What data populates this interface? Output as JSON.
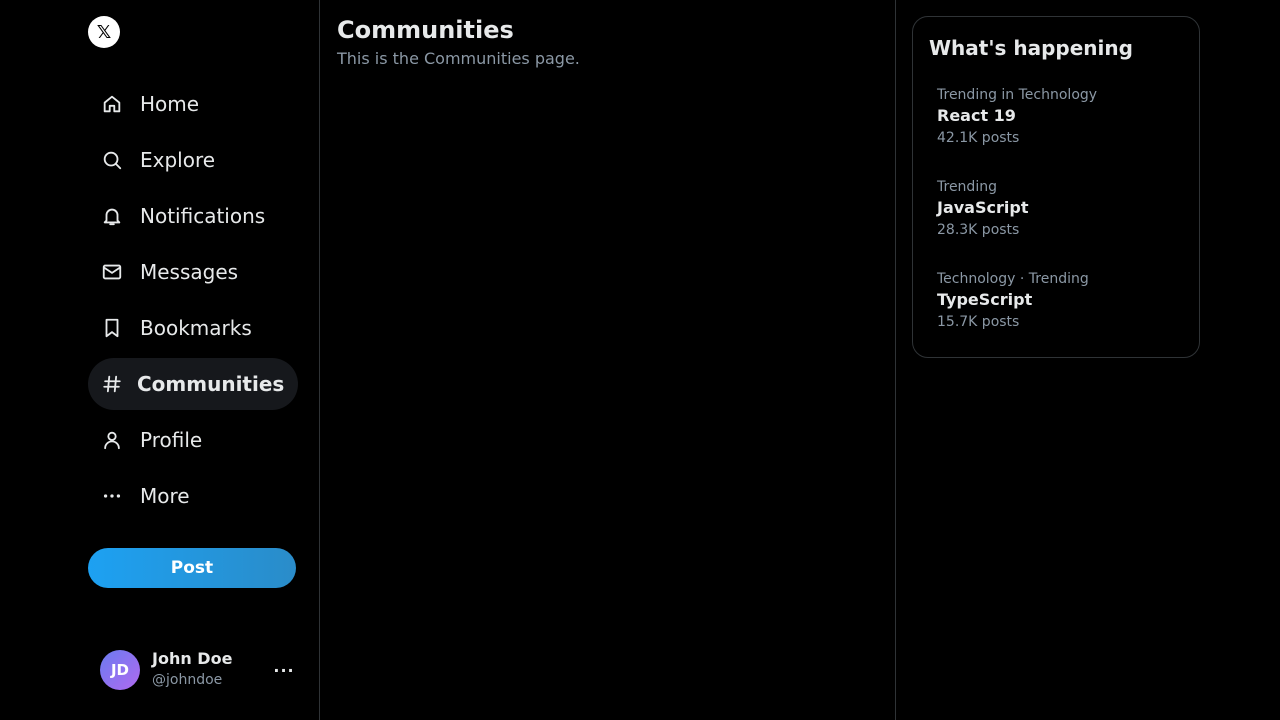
{
  "logo": {
    "glyph": "𝕏"
  },
  "nav": {
    "items": [
      {
        "label": "Home",
        "icon": "home-icon"
      },
      {
        "label": "Explore",
        "icon": "search-icon"
      },
      {
        "label": "Notifications",
        "icon": "bell-icon"
      },
      {
        "label": "Messages",
        "icon": "mail-icon"
      },
      {
        "label": "Bookmarks",
        "icon": "bookmark-icon"
      },
      {
        "label": "Communities",
        "icon": "hash-icon",
        "active": true
      },
      {
        "label": "Profile",
        "icon": "user-icon"
      },
      {
        "label": "More",
        "icon": "more-dots-icon"
      }
    ]
  },
  "post_button": {
    "label": "Post"
  },
  "account": {
    "initials": "JD",
    "name": "John Doe",
    "handle": "@johndoe",
    "more": "···"
  },
  "main": {
    "title": "Communities",
    "description": "This is the Communities page."
  },
  "trends": {
    "title": "What's happening",
    "items": [
      {
        "context": "Trending in Technology",
        "name": "React 19",
        "count": "42.1K posts"
      },
      {
        "context": "Trending",
        "name": "JavaScript",
        "count": "28.3K posts"
      },
      {
        "context": "Technology · Trending",
        "name": "TypeScript",
        "count": "15.7K posts"
      }
    ]
  },
  "colors": {
    "background": "#000000",
    "text": "#e7e9ea",
    "muted": "#8b98a5",
    "accent": "#1da1f2",
    "border": "#2f3336"
  }
}
